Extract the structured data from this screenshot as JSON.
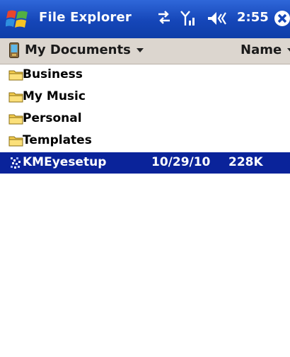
{
  "titlebar": {
    "title": "File Explorer",
    "time": "2:55",
    "icons": [
      "windows-start-icon",
      "connectivity-icon",
      "signal-icon",
      "volume-icon",
      "close-icon"
    ]
  },
  "toolbar": {
    "folder": "My Documents",
    "sort": "Name"
  },
  "files": [
    {
      "type": "folder",
      "name": "Business"
    },
    {
      "type": "folder",
      "name": "My Music"
    },
    {
      "type": "folder",
      "name": "Personal"
    },
    {
      "type": "folder",
      "name": "Templates"
    },
    {
      "type": "file",
      "name": "KMEyesetup",
      "date": "10/29/10",
      "size": "228K",
      "selected": true
    }
  ],
  "colors": {
    "titlebar": "#1546b8",
    "selection": "#0a239a",
    "toolbar": "#dcd6cf"
  }
}
